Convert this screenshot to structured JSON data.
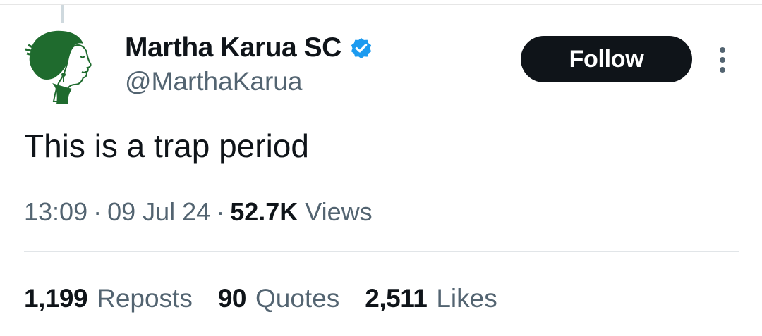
{
  "tweet": {
    "author": {
      "display_name": "Martha Karua SC",
      "handle": "@MarthaKarua",
      "verified": true,
      "avatar_icon": "profile-silhouette-green"
    },
    "follow_label": "Follow",
    "more_icon": "more-vertical-icon",
    "text": "This is a trap period",
    "meta": {
      "time": "13:09",
      "separator": "·",
      "date": "09 Jul 24",
      "views_count": "52.7K",
      "views_label": "Views"
    },
    "stats": [
      {
        "count": "1,199",
        "label": "Reposts"
      },
      {
        "count": "90",
        "label": "Quotes"
      },
      {
        "count": "2,511",
        "label": "Likes"
      }
    ]
  },
  "colors": {
    "text_primary": "#0f1419",
    "text_secondary": "#536471",
    "verified_blue": "#1d9bf0",
    "follow_bg": "#0f1419",
    "avatar_green": "#1f6b2e"
  }
}
